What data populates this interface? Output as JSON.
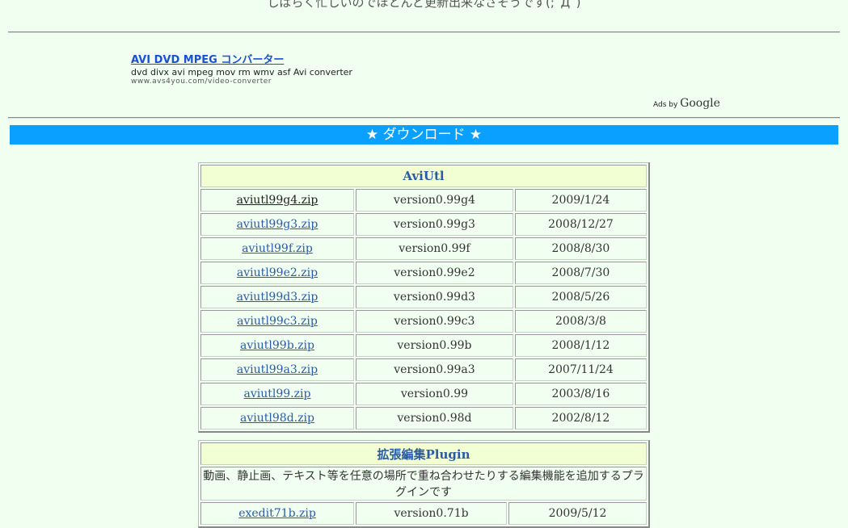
{
  "top_note": "しばらく忙しいのでほとんど更新出来なさそうです(;´Д`)",
  "ad": {
    "title": "AVI DVD MPEG コンバーター",
    "desc": "dvd divx avi mpeg mov rm wmv asf Avi converter",
    "url": "www.avs4you.com/video-converter"
  },
  "ads_by": {
    "prefix": "Ads by ",
    "brand": "Google"
  },
  "banner": "★ ダウンロード ★",
  "aviutl": {
    "title": "AviUtl",
    "rows": [
      {
        "file": "aviutl99g4.zip",
        "version": "version0.99g4",
        "date": "2009/1/24"
      },
      {
        "file": "aviutl99g3.zip",
        "version": "version0.99g3",
        "date": "2008/12/27"
      },
      {
        "file": "aviutl99f.zip",
        "version": "version0.99f",
        "date": "2008/8/30"
      },
      {
        "file": "aviutl99e2.zip",
        "version": "version0.99e2",
        "date": "2008/7/30"
      },
      {
        "file": "aviutl99d3.zip",
        "version": "version0.99d3",
        "date": "2008/5/26"
      },
      {
        "file": "aviutl99c3.zip",
        "version": "version0.99c3",
        "date": "2008/3/8"
      },
      {
        "file": "aviutl99b.zip",
        "version": "version0.99b",
        "date": "2008/1/12"
      },
      {
        "file": "aviutl99a3.zip",
        "version": "version0.99a3",
        "date": "2007/11/24"
      },
      {
        "file": "aviutl99.zip",
        "version": "version0.99",
        "date": "2003/8/16"
      },
      {
        "file": "aviutl98d.zip",
        "version": "version0.98d",
        "date": "2002/8/12"
      }
    ]
  },
  "plugin": {
    "title": "拡張編集Plugin",
    "description": "動画、静止画、テキスト等を任意の場所で重ね合わせたりする編集機能を追加するプラグインです",
    "rows": [
      {
        "file": "exedit71b.zip",
        "version": "version0.71b",
        "date": "2009/5/12"
      }
    ]
  }
}
